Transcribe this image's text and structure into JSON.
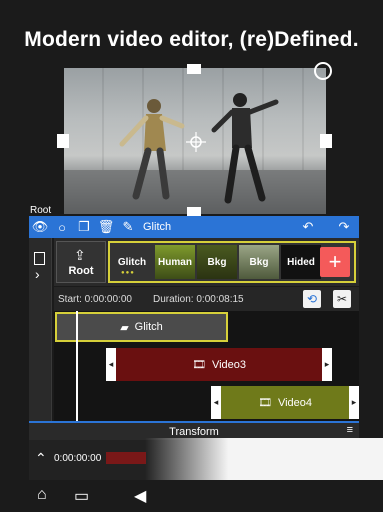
{
  "headline": "Modern video editor, (re)Defined.",
  "preview": {
    "root_label": "Root"
  },
  "toolbar": {
    "layer_name": "Glitch"
  },
  "layers": {
    "root_label": "Root",
    "items": [
      "Glitch",
      "Human",
      "Bkg",
      "Bkg",
      "Hided"
    ],
    "add_symbol": "+"
  },
  "timebar": {
    "start": "Start: 0:00:00:00",
    "duration": "Duration: 0:00:08:15"
  },
  "tracks": {
    "glitch": "Glitch",
    "video3": "Video3",
    "video4": "Video4"
  },
  "transform": {
    "title": "Transform"
  },
  "mini_timeline": {
    "time": "0:00:00:00"
  },
  "icons": [
    "eye-icon",
    "circle-icon",
    "copy-icon",
    "trash-icon",
    "pen-icon",
    "undo-icon",
    "redo-icon",
    "layers-icon",
    "chevron-right-icon",
    "upload-icon",
    "replay-icon",
    "scissors-icon",
    "home-icon",
    "comment-icon",
    "back-icon"
  ],
  "colors": {
    "accent": "#2b74d6",
    "highlight": "#d6d03a",
    "add": "#f45a5a",
    "video3": "#6a1010",
    "video4": "#6f7a1a"
  }
}
